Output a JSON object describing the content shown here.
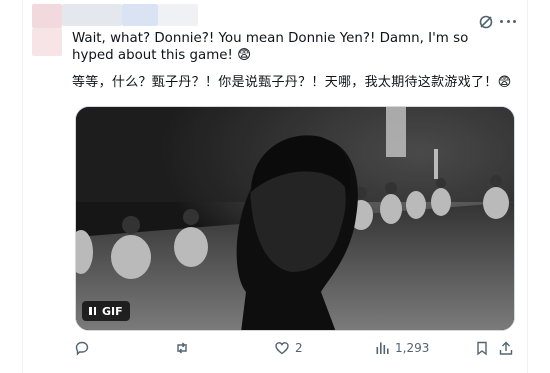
{
  "post": {
    "text_en": "Wait, what? Donnie?! You mean Donnie Yen?! Damn, I'm so hyped about this game! 😨",
    "text_zh": "等等，什么？甄子丹？！你是说甄子丹？！天哪，我太期待这款游戏了！😨"
  },
  "media": {
    "badge_label": "GIF"
  },
  "actions": {
    "replies": "",
    "reposts": "",
    "likes": "2",
    "views": "1,293"
  },
  "icons": [
    "grok-icon",
    "more-icon",
    "reply-icon",
    "repost-icon",
    "like-icon",
    "views-icon",
    "bookmark-icon",
    "share-icon",
    "pause-icon"
  ],
  "colors": {
    "icon_gray": "#536471",
    "text": "#0f1419"
  }
}
